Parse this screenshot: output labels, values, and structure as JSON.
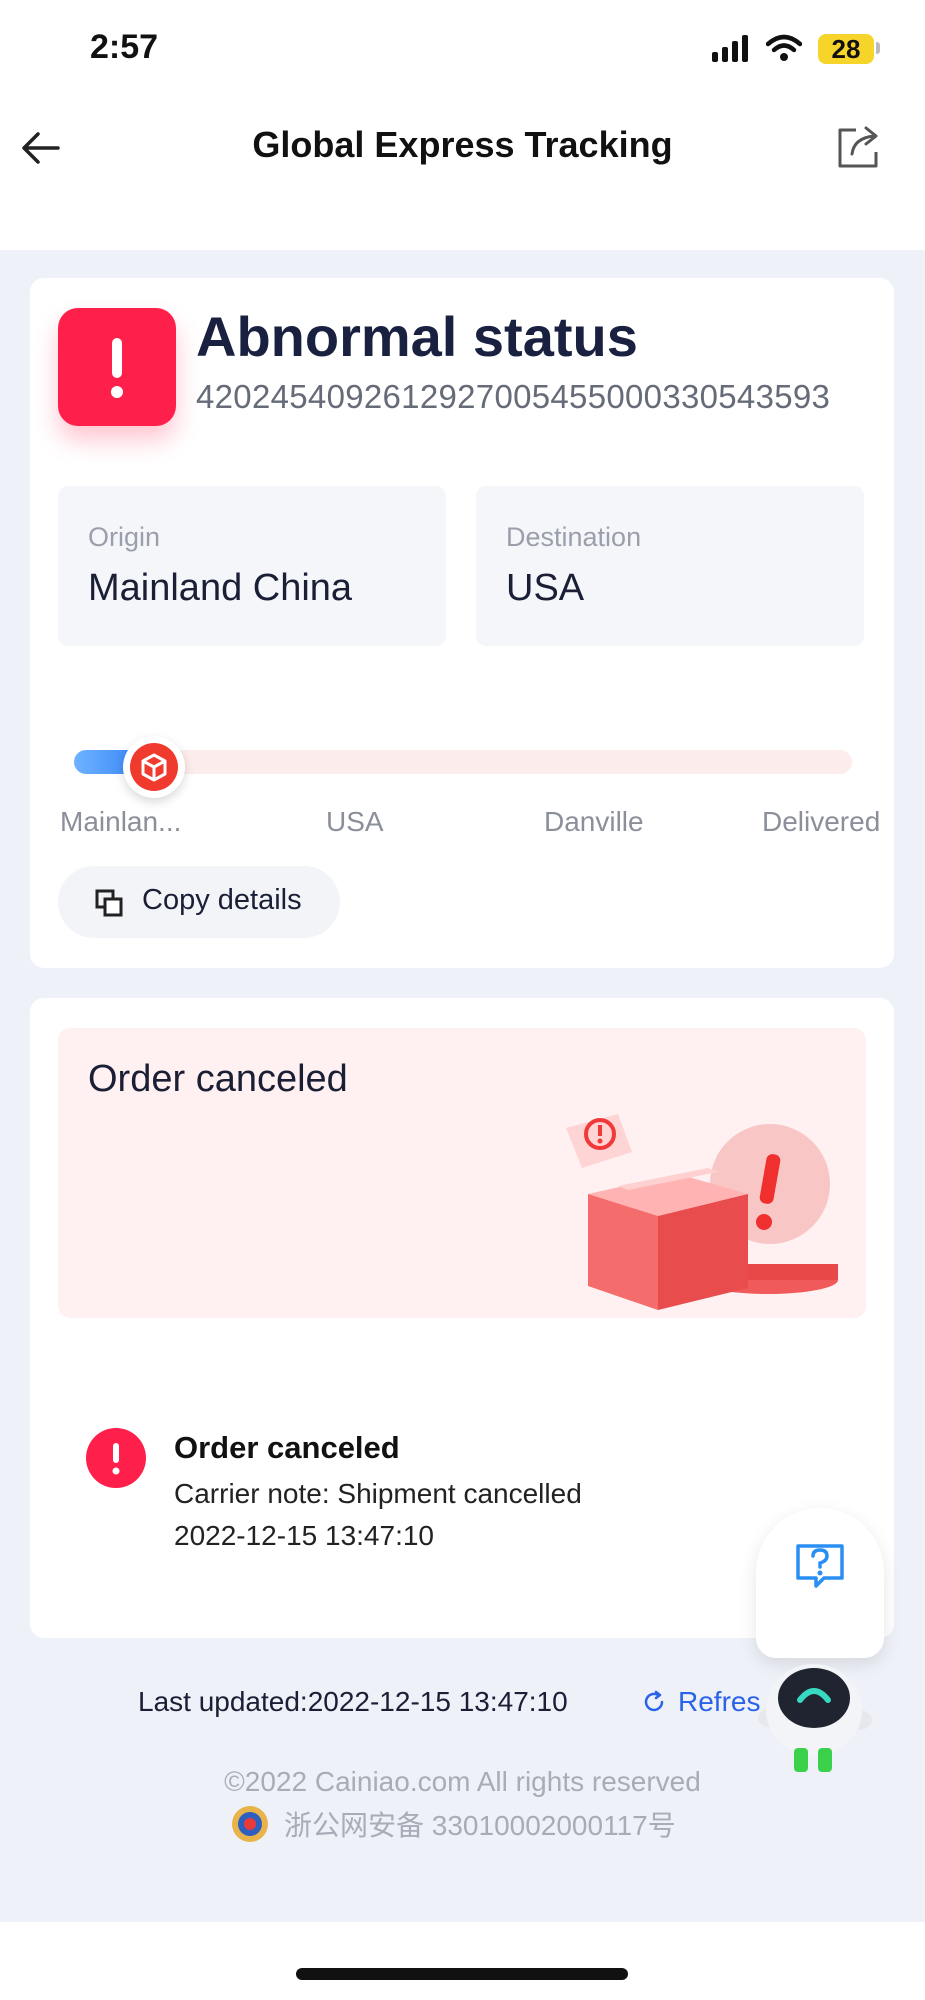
{
  "status_bar": {
    "time": "2:57",
    "battery": "28"
  },
  "nav": {
    "title": "Global Express Tracking"
  },
  "shipment": {
    "status": "Abnormal status",
    "tracking_number": "4202454092612927005455000330543593",
    "origin_label": "Origin",
    "origin_value": "Mainland China",
    "destination_label": "Destination",
    "destination_value": "USA",
    "progress_fraction": 0.13,
    "stops": [
      "Mainlan...",
      "USA",
      "Danville",
      "Delivered"
    ],
    "copy_label": "Copy details"
  },
  "cancel_banner": {
    "title": "Order canceled"
  },
  "events": [
    {
      "title": "Order canceled",
      "note": "Carrier note: Shipment cancelled",
      "time": "2022-12-15 13:47:10"
    }
  ],
  "footer": {
    "last_updated": "Last updated:2022-12-15 13:47:10",
    "refresh_label": "Refres",
    "copyright": "©2022  Cainiao.com  All rights reserved",
    "icp": "浙公网安备 33010002000117号"
  },
  "colors": {
    "alert": "#ff1f4b",
    "accent_blue": "#2a63e8",
    "page_bg": "#eef1f8"
  },
  "icons": [
    "back-arrow-icon",
    "share-icon",
    "exclamation-icon",
    "package-icon",
    "copy-icon",
    "refresh-icon",
    "help-icon",
    "robot-mascot-icon",
    "police-badge-icon"
  ]
}
